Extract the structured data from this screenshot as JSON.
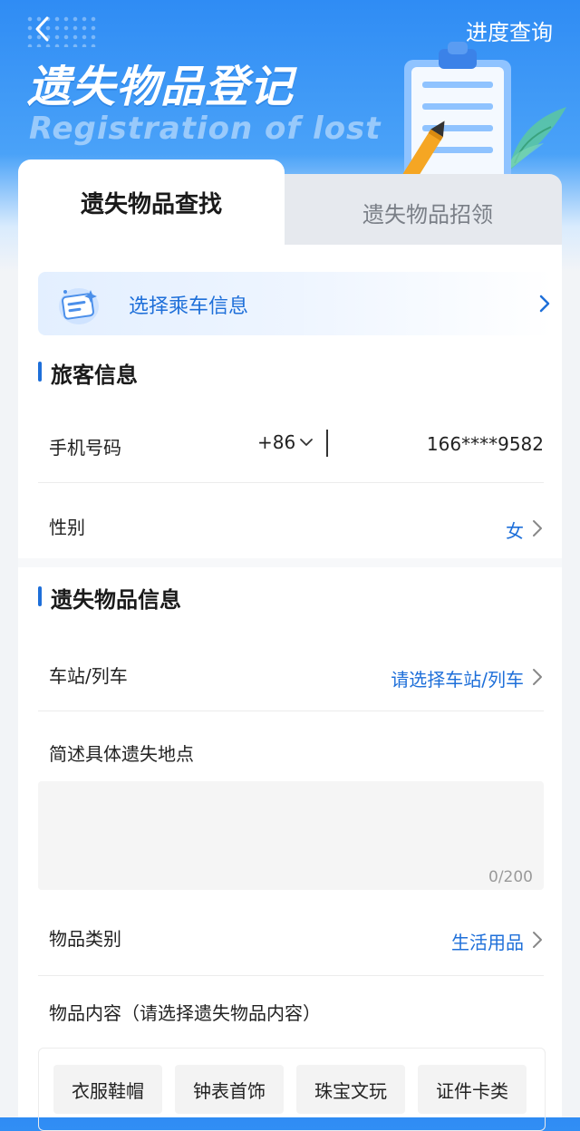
{
  "header": {
    "progress_link": "进度查询",
    "title_zh": "遗失物品登记",
    "title_en": "Registration of lost"
  },
  "tabs": [
    {
      "label": "遗失物品查找",
      "active": true
    },
    {
      "label": "遗失物品招领",
      "active": false
    }
  ],
  "ride_banner": {
    "label": "选择乘车信息",
    "icon": "ticket-icon"
  },
  "passenger_section": {
    "title": "旅客信息",
    "phone": {
      "label": "手机号码",
      "country_code": "+86",
      "value": "166****9582"
    },
    "gender": {
      "label": "性别",
      "value": "女"
    }
  },
  "item_section": {
    "title": "遗失物品信息",
    "station": {
      "label": "车站/列车",
      "placeholder": "请选择车站/列车"
    },
    "location": {
      "label": "简述具体遗失地点",
      "value": "",
      "counter": "0/200"
    },
    "category": {
      "label": "物品类别",
      "value": "生活用品"
    },
    "content": {
      "label": "物品内容（请选择遗失物品内容）",
      "options": [
        "衣服鞋帽",
        "钟表首饰",
        "珠宝文玩",
        "证件卡类"
      ]
    }
  },
  "colors": {
    "brand_blue": "#1e6fd9",
    "header_blue": "#2f8cf4"
  }
}
